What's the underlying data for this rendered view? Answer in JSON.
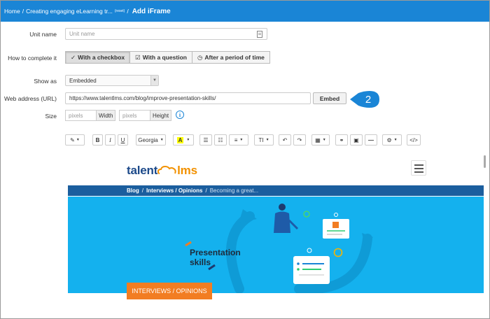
{
  "breadcrumb": {
    "home": "Home",
    "separator": "/",
    "course": "Creating engaging eLearning tr...",
    "course_badge": "(reset)",
    "current": "Add iFrame"
  },
  "form": {
    "unit_name_label": "Unit name",
    "unit_name_placeholder": "Unit name",
    "complete_label": "How to complete it",
    "complete_options": [
      {
        "label": "With a checkbox",
        "icon": "checkmark-icon",
        "selected": true
      },
      {
        "label": "With a question",
        "icon": "checkbox-icon",
        "selected": false
      },
      {
        "label": "After a period of time",
        "icon": "clock-icon",
        "selected": false
      }
    ],
    "show_as_label": "Show as",
    "show_as_value": "Embedded",
    "web_address_label": "Web address (URL)",
    "web_address_value": "https://www.talentlms.com/blog/improve-presentation-skills/",
    "embed_button": "Embed",
    "callout_number": "2",
    "size_label": "Size",
    "width_placeholder": "pixels",
    "width_addon": "Width",
    "height_placeholder": "pixels",
    "height_addon": "Height"
  },
  "toolbar": {
    "font_name": "Georgia",
    "bold": "B",
    "italic": "I",
    "underline": "U",
    "font_color": "A",
    "text_size": "TI"
  },
  "preview": {
    "logo_talent": "talent",
    "logo_lms": "lms",
    "crumbs": [
      "Blog",
      "Interviews / Opinions"
    ],
    "crumb_current": "Becoming a great...",
    "hero_text_line1": "Presentation",
    "hero_text_line2": "skills",
    "tag": "INTERVIEWS / OPINIONS"
  },
  "colors": {
    "topbar": "#1a85d6",
    "accent": "#1a85d6",
    "hero": "#14b1ee",
    "tag": "#f27d22",
    "crumb_bar": "#1b5e9e"
  }
}
